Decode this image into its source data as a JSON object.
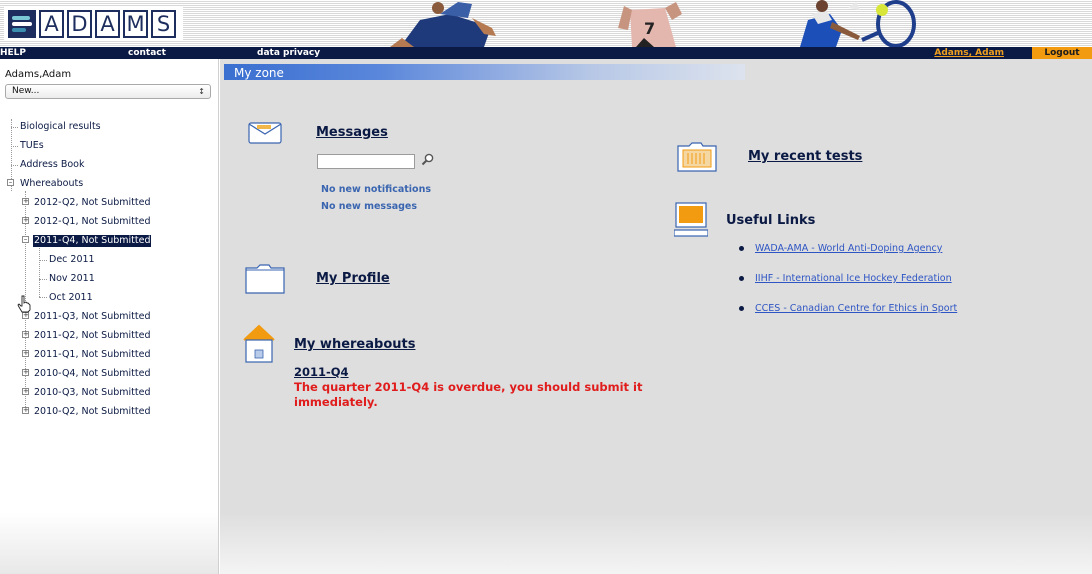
{
  "banner": {
    "logo_letters": [
      "A",
      "D",
      "A",
      "M",
      "S"
    ]
  },
  "navbar": {
    "help": "HELP",
    "contact": "contact",
    "data_privacy": "data privacy",
    "user": "Adams, Adam",
    "logout": "Logout"
  },
  "sidebar": {
    "user_name": "Adams,Adam",
    "select_value": "New...",
    "items": [
      {
        "label": "Biological results"
      },
      {
        "label": "TUEs"
      },
      {
        "label": "Address Book"
      },
      {
        "label": "Whereabouts"
      }
    ],
    "quarters": [
      {
        "label": "2012-Q2, Not Submitted"
      },
      {
        "label": "2012-Q1, Not Submitted"
      },
      {
        "label": "2011-Q4, Not Submitted"
      },
      {
        "label": "2011-Q3, Not Submitted"
      },
      {
        "label": "2011-Q2, Not Submitted"
      },
      {
        "label": "2011-Q1, Not Submitted"
      },
      {
        "label": "2010-Q4, Not Submitted"
      },
      {
        "label": "2010-Q3, Not Submitted"
      },
      {
        "label": "2010-Q2, Not Submitted"
      }
    ],
    "months": [
      {
        "label": "Dec 2011"
      },
      {
        "label": "Nov 2011"
      },
      {
        "label": "Oct 2011"
      }
    ]
  },
  "main": {
    "zone_title": "My zone",
    "messages": {
      "title": "Messages",
      "notifications": "No new notifications",
      "messages": "No new messages"
    },
    "profile": {
      "title": "My Profile"
    },
    "whereabouts": {
      "title": "My whereabouts",
      "quarter": "2011-Q4",
      "warning": "The quarter 2011-Q4 is overdue, you should submit it immediately."
    },
    "recent_tests": {
      "title": "My recent tests"
    },
    "useful_links": {
      "title": "Useful Links",
      "links": [
        {
          "label": "WADA-AMA - World Anti-Doping Agency"
        },
        {
          "label": "IIHF - International Ice Hockey Federation"
        },
        {
          "label": "CCES - Canadian Centre for Ethics in Sport"
        }
      ]
    }
  },
  "colors": {
    "navy": "#0b1a44",
    "orange": "#f29b11",
    "warning_red": "#e01c1c",
    "link_blue": "#2e55c4",
    "zone_bar_blue": "#3a6fd0"
  },
  "icons": [
    "envelope-icon",
    "magnifier-icon",
    "folder-icon",
    "house-icon",
    "test-folder-icon",
    "computer-icon",
    "hand-cursor-icon"
  ]
}
